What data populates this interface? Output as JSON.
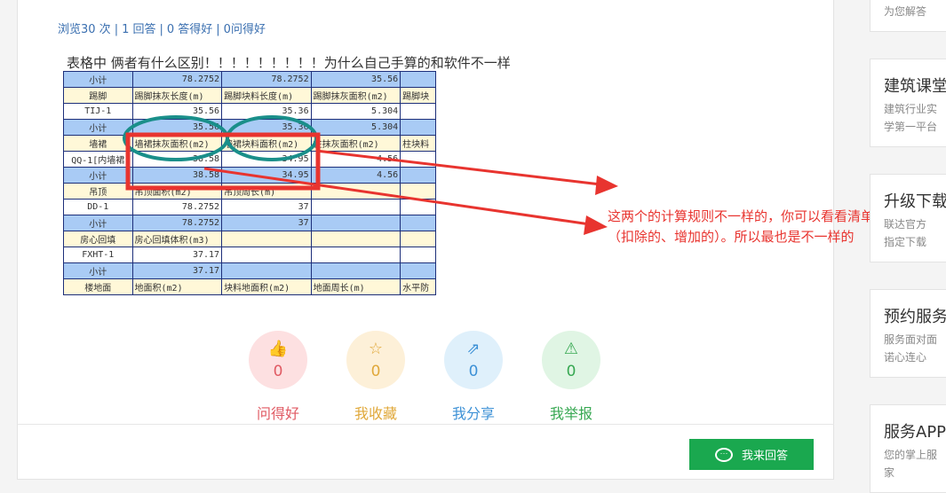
{
  "stats": {
    "views": "浏览30 次",
    "answers": "1 回答",
    "good_answers": "0 答得好",
    "good_questions": "0问得好",
    "separator": "|"
  },
  "question_text": "表格中  俩者有什么区别！！！！！！！！！为什么自己手算的和软件不一样",
  "sheet": {
    "rows": [
      {
        "type": "sub",
        "cells": [
          "小计",
          "78.2752",
          "78.2752",
          "35.56",
          ""
        ]
      },
      {
        "type": "hdr",
        "cells": [
          "踢脚",
          "踢脚抹灰长度(m)",
          "踢脚块料长度(m)",
          "踢脚抹灰面积(m2)",
          "踢脚块"
        ]
      },
      {
        "type": "row",
        "cells": [
          "TIJ-1",
          "35.56",
          "35.36",
          "5.304",
          ""
        ]
      },
      {
        "type": "sub",
        "cells": [
          "小计",
          "35.56",
          "35.36",
          "5.304",
          ""
        ]
      },
      {
        "type": "hdr",
        "cells": [
          "墙裙",
          "墙裙抹灰面积(m2)",
          "墙裙块料面积(m2)",
          "柱抹灰面积(m2)",
          "柱块料"
        ]
      },
      {
        "type": "row",
        "cells": [
          "QQ-1[内墙裙",
          "38.58",
          "34.95",
          "4.56",
          ""
        ]
      },
      {
        "type": "sub",
        "cells": [
          "小计",
          "38.58",
          "34.95",
          "4.56",
          ""
        ]
      },
      {
        "type": "hdr",
        "cells": [
          "吊顶",
          "吊顶面积(m2)",
          "吊顶周长(m)",
          "",
          ""
        ]
      },
      {
        "type": "row",
        "cells": [
          "DD-1",
          "78.2752",
          "37",
          "",
          ""
        ]
      },
      {
        "type": "sub",
        "cells": [
          "小计",
          "78.2752",
          "37",
          "",
          ""
        ]
      },
      {
        "type": "hdr",
        "cells": [
          "房心回填",
          "房心回填体积(m3)",
          "",
          "",
          ""
        ]
      },
      {
        "type": "row",
        "cells": [
          "FXHT-1",
          "37.17",
          "",
          "",
          ""
        ]
      },
      {
        "type": "sub",
        "cells": [
          "小计",
          "37.17",
          "",
          "",
          ""
        ]
      },
      {
        "type": "hdr",
        "cells": [
          "楼地面",
          "地面积(m2)",
          "块料地面积(m2)",
          "地面周长(m)",
          "水平防"
        ]
      }
    ]
  },
  "annotation": "这两个的计算规则不一样的，你可以看看清单计算规则（扣除的、增加的）。所以最也是不一样的",
  "actions": [
    {
      "icon": "👍",
      "count": "0",
      "label": "问得好"
    },
    {
      "icon": "☆",
      "count": "0",
      "label": "我收藏"
    },
    {
      "icon": "⇗",
      "count": "0",
      "label": "我分享"
    },
    {
      "icon": "⚠",
      "count": "0",
      "label": "我举报"
    }
  ],
  "answer_button": "我来回答",
  "sidebar": {
    "top_desc": "为您解答",
    "cards": [
      {
        "title": "建筑课堂",
        "desc1": "建筑行业实",
        "desc2": "学第一平台"
      },
      {
        "title": "升级下载",
        "desc1": "联达官方",
        "desc2": "指定下载"
      },
      {
        "title": "预约服务",
        "desc1": "服务面对面",
        "desc2": "诺心连心"
      },
      {
        "title": "服务APP",
        "desc1": "您的掌上服",
        "desc2": "家"
      }
    ]
  },
  "colors": {
    "red": "#e8342f",
    "teal": "#1a8f8a",
    "green": "#1aa84f",
    "link": "#3a6fb0"
  }
}
